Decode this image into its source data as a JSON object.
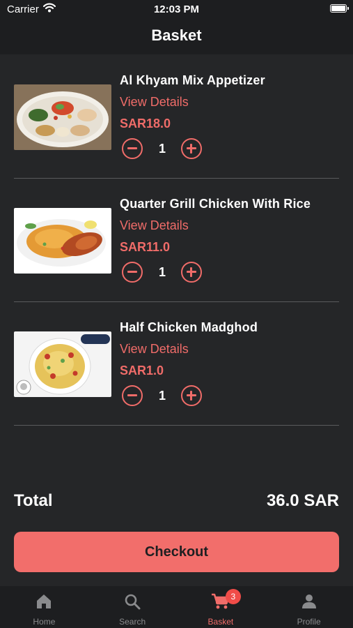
{
  "status_bar": {
    "carrier": "Carrier",
    "time": "12:03 PM"
  },
  "nav": {
    "title": "Basket"
  },
  "basket": {
    "items": [
      {
        "name": "Al Khyam Mix Appetizer",
        "details_label": "View Details",
        "price": "SAR18.0",
        "quantity": "1"
      },
      {
        "name": " Quarter Grill Chicken With Rice",
        "details_label": "View Details",
        "price": "SAR11.0",
        "quantity": "1"
      },
      {
        "name": "Half Chicken Madghod",
        "details_label": "View Details",
        "price": "SAR1.0",
        "quantity": "1"
      }
    ]
  },
  "total": {
    "label": "Total",
    "value": "36.0 SAR"
  },
  "checkout": {
    "label": "Checkout"
  },
  "tab_bar": {
    "tabs": [
      {
        "label": "Home",
        "icon": "home-icon"
      },
      {
        "label": "Search",
        "icon": "search-icon"
      },
      {
        "label": "Basket",
        "icon": "cart-icon",
        "badge": "3",
        "active": true
      },
      {
        "label": "Profile",
        "icon": "profile-icon"
      }
    ]
  },
  "colors": {
    "accent": "#f06c69",
    "button": "#f26e6b",
    "badge": "#f04c48",
    "background": "#252628",
    "bar": "#1d1e20"
  }
}
